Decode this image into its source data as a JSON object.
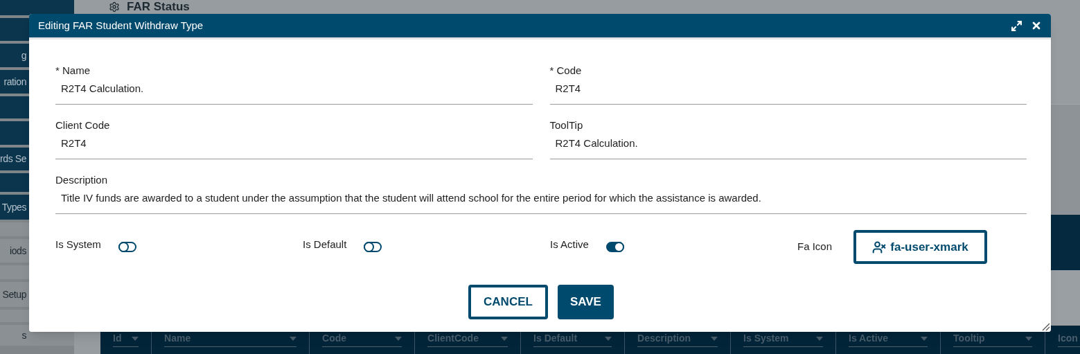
{
  "sidebar": {
    "items": [
      {
        "label": "g"
      },
      {
        "label": "ration"
      },
      {
        "label": "rds Se"
      },
      {
        "label": "Types"
      },
      {
        "label": "iods"
      },
      {
        "label": "Setup"
      },
      {
        "label": "s"
      }
    ]
  },
  "page": {
    "title": "FAR Status"
  },
  "table": {
    "columns": [
      "Id",
      "Name",
      "Code",
      "ClientCode",
      "Is Default",
      "Description",
      "Is System",
      "Is Active",
      "Tooltip",
      "Icon"
    ]
  },
  "dialog": {
    "title": "Editing FAR Student Withdraw Type",
    "fields": [
      {
        "label": "* Name",
        "value": "R2T4 Calculation.",
        "kind": "half"
      },
      {
        "label": "* Code",
        "value": "R2T4",
        "kind": "half"
      },
      {
        "label": "Client Code",
        "value": "R2T4",
        "kind": "half"
      },
      {
        "label": "ToolTip",
        "value": "R2T4 Calculation.",
        "kind": "half"
      },
      {
        "label": "Description",
        "value": "Title IV funds are awarded to a student under the assumption that the student will attend school for the entire period for which the assistance is awarded.",
        "kind": "wide"
      }
    ],
    "toggles": [
      {
        "label": "Is System",
        "on": false
      },
      {
        "label": "Is Default",
        "on": false
      },
      {
        "label": "Is Active",
        "on": true
      }
    ],
    "fa_icon": {
      "label": "Fa Icon",
      "value": "fa-user-xmark"
    },
    "buttons": [
      {
        "label": "CANCEL",
        "kind": "outline"
      },
      {
        "label": "SAVE",
        "kind": "filled"
      }
    ]
  }
}
